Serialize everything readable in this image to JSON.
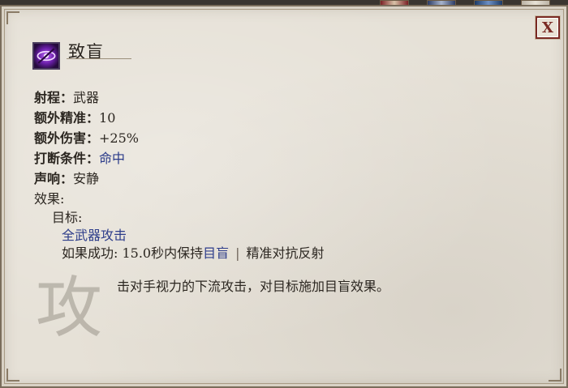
{
  "top_strip": {
    "icons": [
      "portrait-icon-red",
      "portrait-icon-blue",
      "portrait-icon-navy",
      "portrait-icon-white"
    ]
  },
  "close_button": {
    "label": "X"
  },
  "ability": {
    "icon": "blind-eye-icon",
    "title": "致盲",
    "stats": [
      {
        "label": "射程：",
        "value": "武器",
        "link": false
      },
      {
        "label": "额外精准：",
        "value": "10",
        "link": false
      },
      {
        "label": "额外伤害：",
        "value": "+25%",
        "link": false
      },
      {
        "label": "打断条件：",
        "value": "命中",
        "link": true
      },
      {
        "label": "声响：",
        "value": "安静",
        "link": false
      }
    ],
    "effects_label": "效果:",
    "target_label": "目标:",
    "target_value": "全武器攻击",
    "on_success_prefix": "如果成功: 15.0秒内保持",
    "on_success_status": "目盲",
    "separator": "|",
    "on_success_suffix": "精准对抗反射",
    "description": "击对手视力的下流攻击，对目标施加目盲效果。",
    "watermark": "攻"
  },
  "colors": {
    "parchment": "#e6e1d7",
    "text": "#2b2620",
    "link": "#2c3c8a",
    "close_red": "#7a2a23",
    "icon_purple": "#6a1fa8"
  }
}
